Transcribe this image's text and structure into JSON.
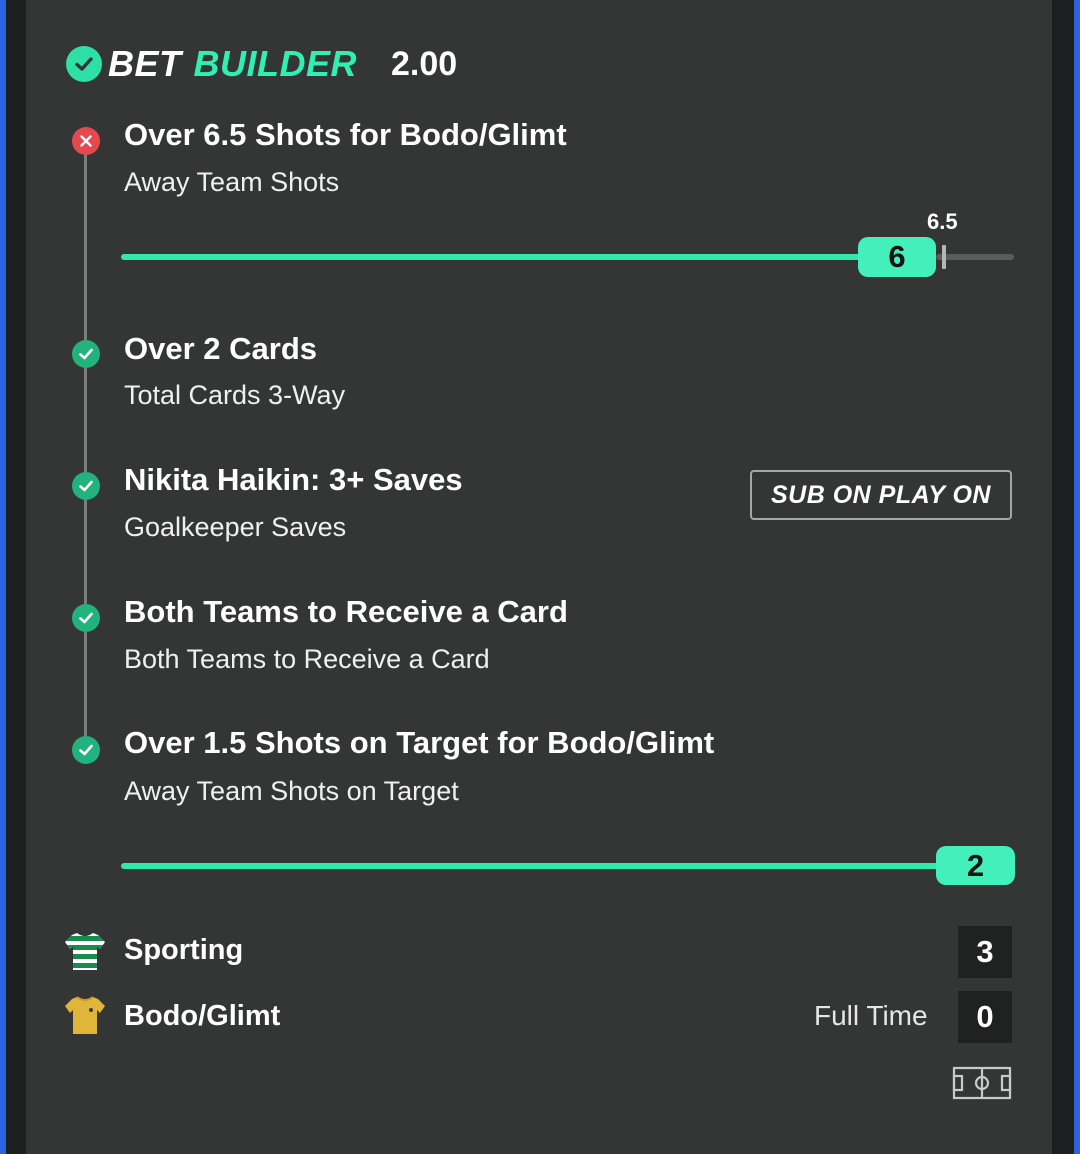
{
  "colors": {
    "accent": "#2ff0b2",
    "card_bg": "#333635",
    "won": "#22b27d",
    "lost": "#e3494f"
  },
  "header": {
    "title_part1": "BET",
    "title_part2": "BUILDER",
    "odds": "2.00",
    "icon": "check-circle-icon"
  },
  "legs": [
    {
      "title": "Over 6.5 Shots for Bodo/Glimt",
      "subtitle": "Away Team Shots",
      "status": "lost",
      "progress": {
        "current": "6",
        "target": "6.5"
      }
    },
    {
      "title": "Over 2 Cards",
      "subtitle": "Total Cards 3-Way",
      "status": "won"
    },
    {
      "title": "Nikita Haikin: 3+ Saves",
      "subtitle": "Goalkeeper Saves",
      "status": "won",
      "badge": "SUB ON PLAY ON"
    },
    {
      "title": "Both Teams to Receive a Card",
      "subtitle": "Both Teams to Receive a Card",
      "status": "won"
    },
    {
      "title": "Over 1.5 Shots on Target for Bodo/Glimt",
      "subtitle": "Away Team Shots on Target",
      "status": "won",
      "progress": {
        "current": "2"
      }
    }
  ],
  "match": {
    "home": {
      "name": "Sporting",
      "score": "3",
      "kit_icon": "striped-shirt-icon"
    },
    "away": {
      "name": "Bodo/Glimt",
      "score": "0",
      "kit_icon": "yellow-shirt-icon"
    },
    "status": "Full Time",
    "pitch_icon": "pitch-icon"
  }
}
